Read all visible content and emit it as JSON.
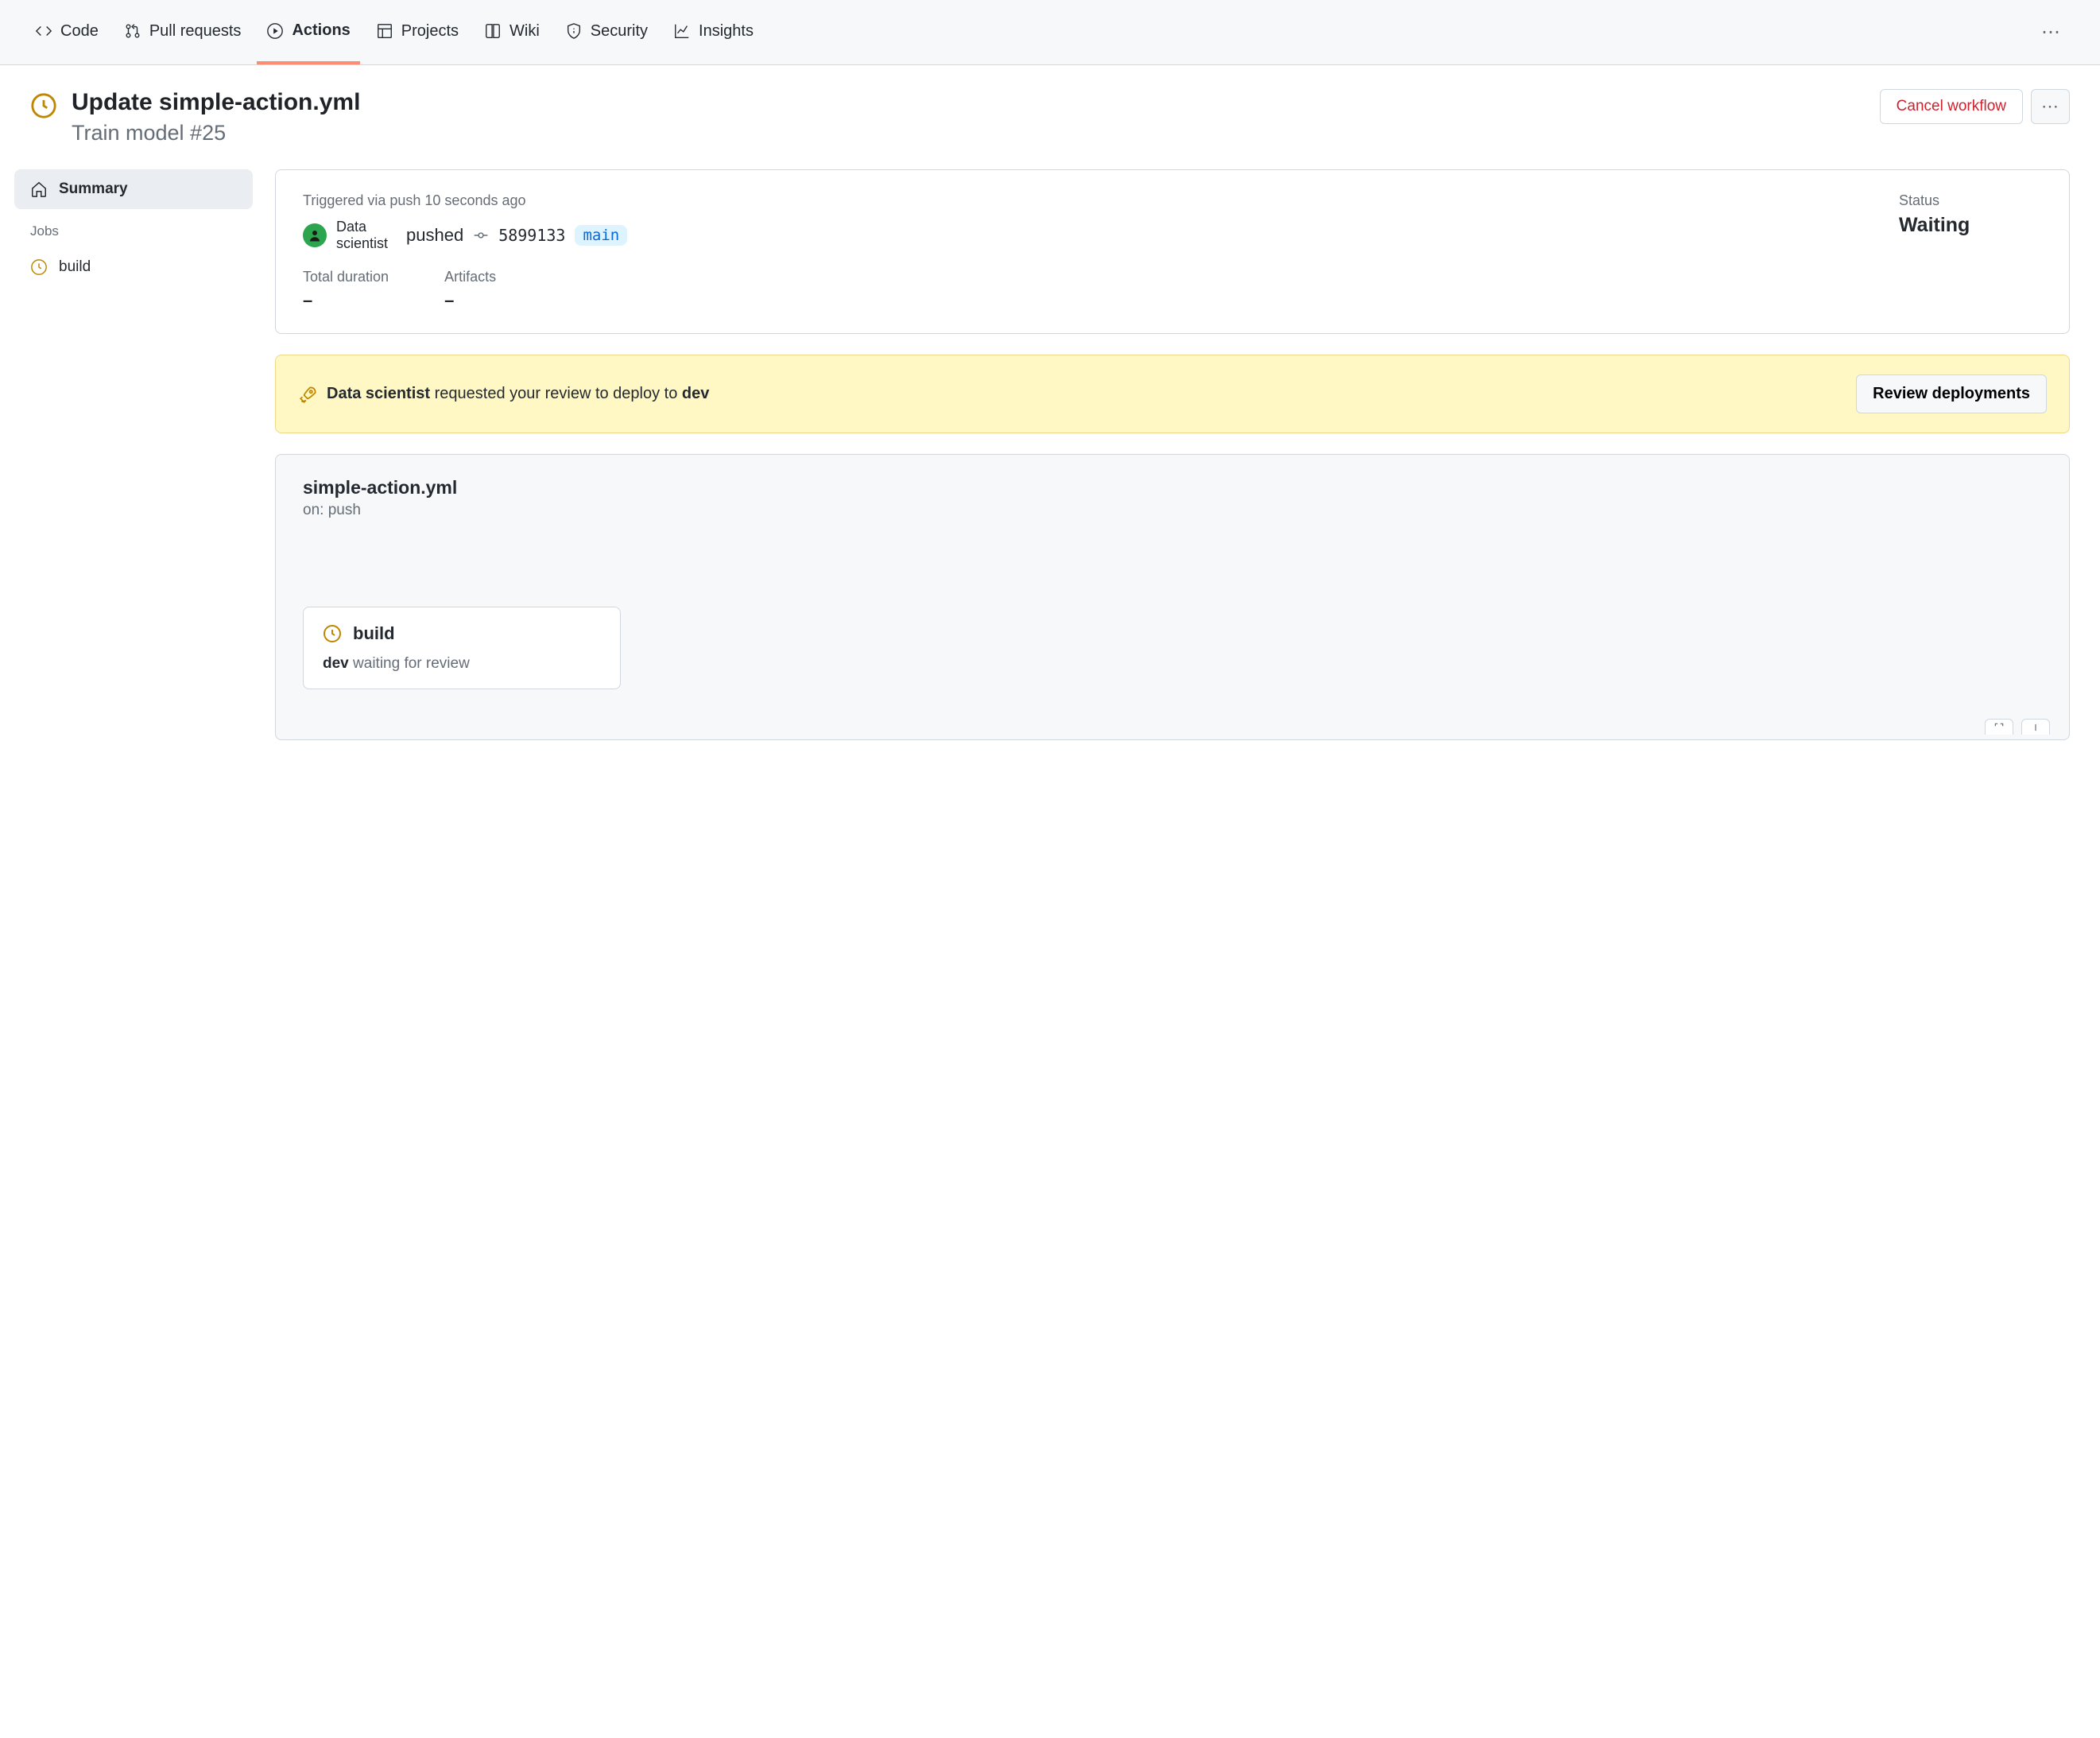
{
  "nav": {
    "items": [
      {
        "label": "Code",
        "icon": "code"
      },
      {
        "label": "Pull requests",
        "icon": "pr"
      },
      {
        "label": "Actions",
        "icon": "play",
        "active": true
      },
      {
        "label": "Projects",
        "icon": "project"
      },
      {
        "label": "Wiki",
        "icon": "book"
      },
      {
        "label": "Security",
        "icon": "shield"
      },
      {
        "label": "Insights",
        "icon": "graph"
      }
    ]
  },
  "header": {
    "title": "Update simple-action.yml",
    "subtitle": "Train model #25",
    "cancel_label": "Cancel workflow"
  },
  "sidebar": {
    "summary_label": "Summary",
    "jobs_heading": "Jobs",
    "jobs": [
      {
        "label": "build"
      }
    ]
  },
  "summary": {
    "trigger_text": "Triggered via push 10 seconds ago",
    "author": "Data scientist",
    "action_text": "pushed",
    "sha": "5899133",
    "branch": "main",
    "status_label": "Status",
    "status_value": "Waiting",
    "duration_label": "Total duration",
    "duration_value": "–",
    "artifacts_label": "Artifacts",
    "artifacts_value": "–"
  },
  "banner": {
    "actor": "Data scientist",
    "message": " requested your review to deploy to ",
    "env": "dev",
    "button": "Review deployments"
  },
  "workflow": {
    "file": "simple-action.yml",
    "on": "on: push",
    "job": {
      "name": "build",
      "env": "dev",
      "status_text": " waiting for review"
    }
  }
}
